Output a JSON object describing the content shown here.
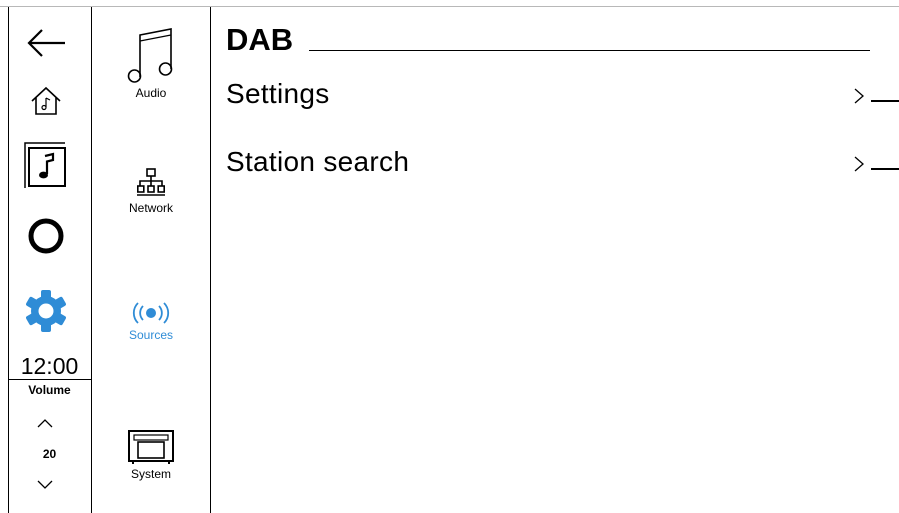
{
  "clock": "12:00",
  "volume": {
    "label": "Volume",
    "value": "20"
  },
  "categories": [
    {
      "label": "Audio",
      "icon": "music-note-icon"
    },
    {
      "label": "Network",
      "icon": "network-icon"
    },
    {
      "label": "Sources",
      "icon": "broadcast-icon"
    },
    {
      "label": "System",
      "icon": "device-icon"
    }
  ],
  "main": {
    "title": "DAB",
    "items": [
      {
        "label": "Settings"
      },
      {
        "label": "Station search"
      }
    ]
  },
  "colors": {
    "accent": "#2f8cd6",
    "text": "#000000",
    "background": "#ffffff"
  }
}
